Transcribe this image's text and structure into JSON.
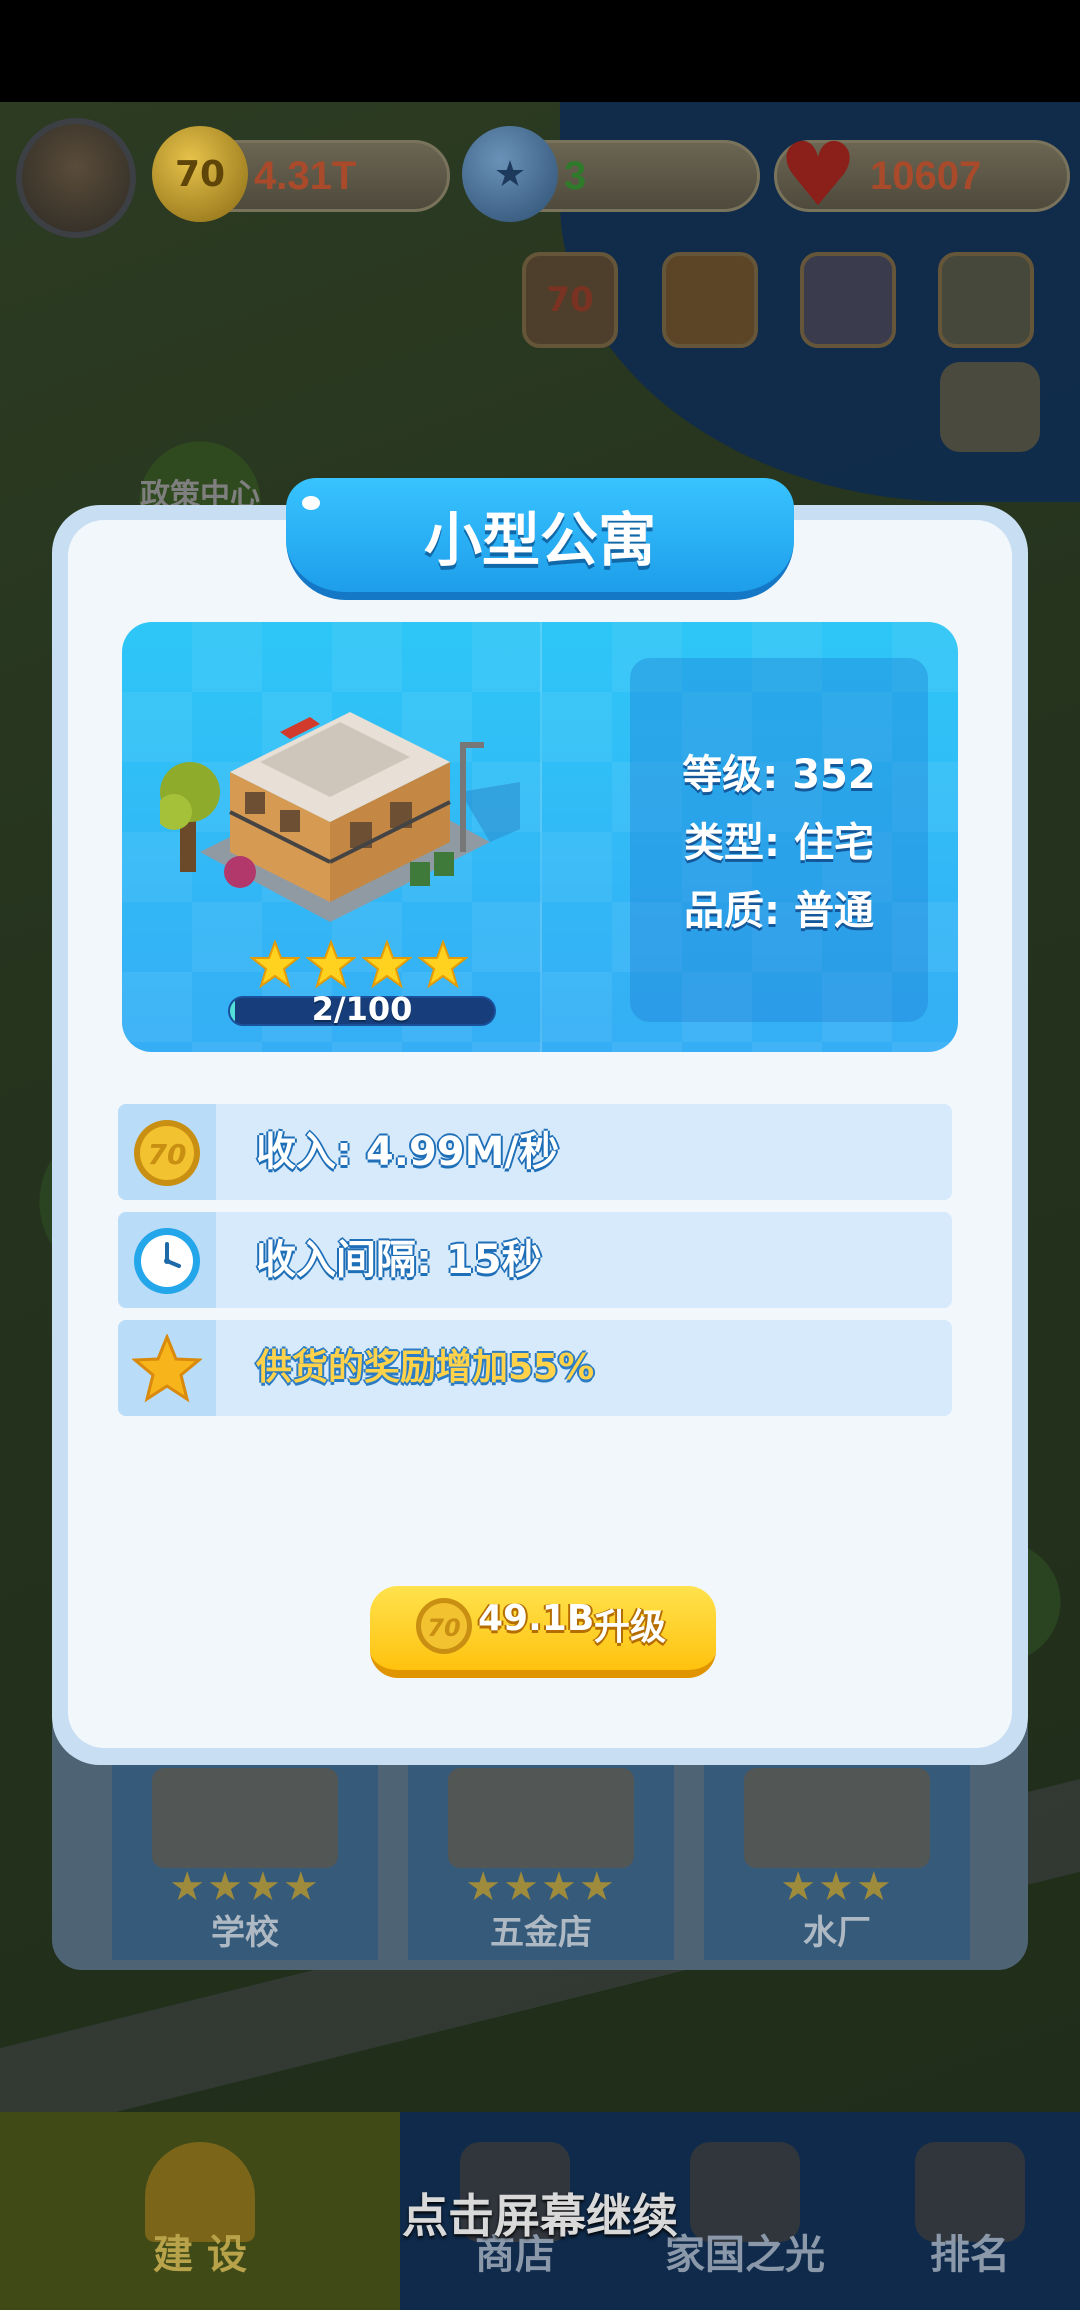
{
  "hud": {
    "coins": "4.31T",
    "gems": "3",
    "hearts": "10607",
    "coin_icon_text": "70",
    "event_icon_text": "70"
  },
  "background": {
    "map_label": "政策中心",
    "cards": [
      {
        "label": "学校",
        "stars": 4
      },
      {
        "label": "五金店",
        "stars": 4
      },
      {
        "label": "水厂",
        "stars": 3
      }
    ]
  },
  "dialog": {
    "title": "小型公寓",
    "building": {
      "stars": 4,
      "progress_text": "2/100",
      "progress_fraction": 0.02
    },
    "info": {
      "level": "等级: 352",
      "type": "类型: 住宅",
      "quality": "品质: 普通"
    },
    "stats": {
      "income": "收入: 4.99M/秒",
      "interval": "收入间隔: 15秒",
      "bonus": "供货的奖励增加55%"
    },
    "upgrade": {
      "coin_text": "70",
      "price": "49.1B",
      "label": "升级"
    }
  },
  "tap_to_continue": "点击屏幕继续",
  "nav": {
    "items": [
      {
        "label": "建 设"
      },
      {
        "label": "商店"
      },
      {
        "label": "家国之光"
      },
      {
        "label": "排名"
      }
    ]
  },
  "colors": {
    "title_blue": "#1e9eea",
    "gold": "#ffc20e",
    "income_text_outline": "#1f6fb8",
    "bonus_text": "#ffd24a"
  }
}
